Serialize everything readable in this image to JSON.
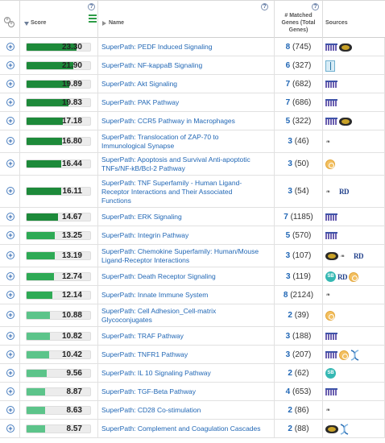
{
  "header": {
    "score_label": "Score",
    "name_label": "Name",
    "matched_label_line1": "# Matched",
    "matched_label_line2": "Genes (Total",
    "matched_label_line3": "Genes)",
    "sources_label": "Sources",
    "help_glyph": "?",
    "expand_glyph": "+"
  },
  "colors": {
    "bar_dark": "#1d8a3a",
    "bar_mid": "#2eaa55",
    "bar_light": "#5cc48a",
    "link": "#2167b5",
    "expand": "#2f67b1"
  },
  "max_score": 23.3,
  "rows": [
    {
      "score": "23.30",
      "name": [
        "SuperPath: PEDF Induced Signaling"
      ],
      "matched": "8",
      "total": "(745)",
      "sources": [
        "db-icon",
        "kegg-icon"
      ]
    },
    {
      "score": "21.90",
      "name": [
        "SuperPath: NF-kappaB Signaling"
      ],
      "matched": "6",
      "total": "(327)",
      "sources": [
        "bio-icon"
      ]
    },
    {
      "score": "19.89",
      "name": [
        "SuperPath: Akt Signaling"
      ],
      "matched": "7",
      "total": "(682)",
      "sources": [
        "db-icon"
      ]
    },
    {
      "score": "19.83",
      "name": [
        "SuperPath: PAK Pathway"
      ],
      "matched": "7",
      "total": "(686)",
      "sources": [
        "db-icon"
      ]
    },
    {
      "score": "17.18",
      "name": [
        "SuperPath: CCR5 Pathway in Macrophages"
      ],
      "matched": "5",
      "total": "(322)",
      "sources": [
        "db-icon",
        "kegg-icon"
      ]
    },
    {
      "score": "16.80",
      "name": [
        "SuperPath: Translocation of ZAP-70 to",
        "Immunological Synapse"
      ],
      "matched": "3",
      "total": "(46)",
      "sources": [
        "reactome-icon"
      ]
    },
    {
      "score": "16.44",
      "name": [
        "SuperPath: Apoptosis and Survival Anti-apoptotic",
        "TNFs/NF-kB/Bcl-2 Pathway"
      ],
      "matched": "3",
      "total": "(50)",
      "sources": [
        "circle-icon"
      ]
    },
    {
      "score": "16.11",
      "name": [
        "SuperPath: TNF Superfamily - Human Ligand-",
        "Receptor Interactions and Their Associated",
        "Functions"
      ],
      "matched": "3",
      "total": "(54)",
      "sources": [
        "reactome-icon",
        "rd-icon"
      ]
    },
    {
      "score": "14.67",
      "name": [
        "SuperPath: ERK Signaling"
      ],
      "matched": "7",
      "total": "(1185)",
      "sources": [
        "db-icon"
      ]
    },
    {
      "score": "13.25",
      "name": [
        "SuperPath: Integrin Pathway"
      ],
      "matched": "5",
      "total": "(570)",
      "sources": [
        "db-icon"
      ]
    },
    {
      "score": "13.19",
      "name": [
        "SuperPath: Chemokine Superfamily: Human/Mouse",
        "Ligand-Receptor Interactions"
      ],
      "matched": "3",
      "total": "(107)",
      "sources": [
        "kegg-icon",
        "reactome-icon",
        "rd-icon"
      ]
    },
    {
      "score": "12.74",
      "name": [
        "SuperPath: Death Receptor Signaling"
      ],
      "matched": "3",
      "total": "(119)",
      "sources": [
        "sb-icon",
        "rd-icon",
        "circle-icon"
      ]
    },
    {
      "score": "12.14",
      "name": [
        "SuperPath: Innate Immune System"
      ],
      "matched": "8",
      "total": "(2124)",
      "sources": [
        "reactome-icon"
      ]
    },
    {
      "score": "10.88",
      "name": [
        "SuperPath: Cell Adhesion_Cell-matrix",
        "Glycoconjugates"
      ],
      "matched": "2",
      "total": "(39)",
      "sources": [
        "circle-icon"
      ]
    },
    {
      "score": "10.82",
      "name": [
        "SuperPath: TRAF Pathway"
      ],
      "matched": "3",
      "total": "(188)",
      "sources": [
        "db-icon"
      ]
    },
    {
      "score": "10.42",
      "name": [
        "SuperPath: TNFR1 Pathway"
      ],
      "matched": "3",
      "total": "(207)",
      "sources": [
        "db-icon",
        "circle-icon",
        "helix-icon"
      ]
    },
    {
      "score": "9.56",
      "name": [
        "SuperPath: IL 10 Signaling Pathway"
      ],
      "matched": "2",
      "total": "(62)",
      "sources": [
        "sb-icon"
      ]
    },
    {
      "score": "8.87",
      "name": [
        "SuperPath: TGF-Beta Pathway"
      ],
      "matched": "4",
      "total": "(653)",
      "sources": [
        "db-icon"
      ]
    },
    {
      "score": "8.63",
      "name": [
        "SuperPath: CD28 Co-stimulation"
      ],
      "matched": "2",
      "total": "(86)",
      "sources": [
        "reactome-icon"
      ]
    },
    {
      "score": "8.57",
      "name": [
        "SuperPath: Complement and Coagulation Cascades"
      ],
      "matched": "2",
      "total": "(88)",
      "sources": [
        "kegg-icon",
        "helix-icon"
      ]
    }
  ]
}
